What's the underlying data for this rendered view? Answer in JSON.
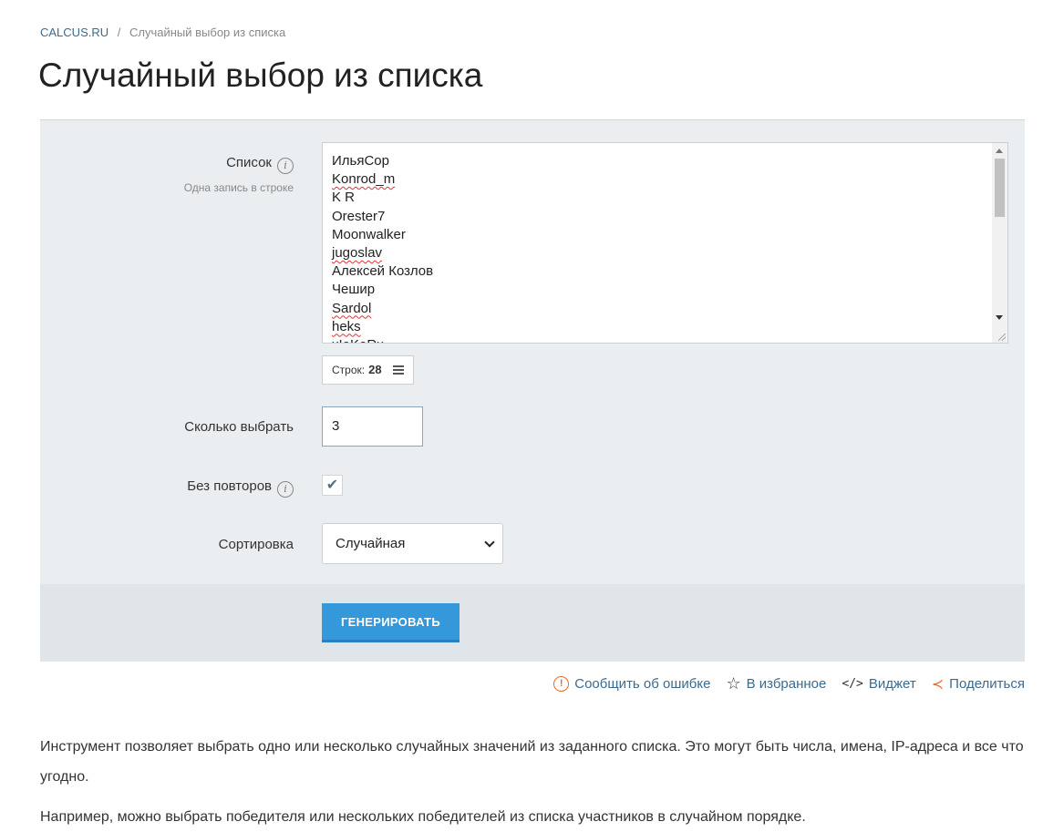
{
  "breadcrumb": {
    "home": "CALCUS.RU",
    "separator": "/",
    "current": "Случайный выбор из списка"
  },
  "page_title": "Случайный выбор из списка",
  "form": {
    "list_label": "Список",
    "list_hint": "Одна запись в строке",
    "list_items": [
      "ИльяCop",
      "Konrod_m",
      "K R",
      "Orester7",
      "Moonwalker",
      "jugoslav",
      "Алексей Козлов",
      "Чешир",
      "Sardol",
      "heks",
      "xIeKeRx"
    ],
    "rows_label": "Строк:",
    "rows_count": "28",
    "count_label": "Сколько выбрать",
    "count_value": "3",
    "norepeat_label": "Без повторов",
    "norepeat_checked": true,
    "sort_label": "Сортировка",
    "sort_value": "Случайная",
    "generate_label": "ГЕНЕРИРОВАТЬ"
  },
  "actions": {
    "report": "Сообщить об ошибке",
    "favorite": "В избранное",
    "widget": "Виджет",
    "share": "Поделиться"
  },
  "description": [
    "Инструмент позволяет выбрать одно или несколько случайных значений из заданного списка. Это могут быть числа, имена, IP-адреса и все что угодно.",
    "Например, можно выбрать победителя или нескольких победителей из списка участников в случайном порядке."
  ],
  "colors": {
    "accent": "#3498db",
    "panel": "#ebeef0",
    "link": "#3a6b8f",
    "icon_orange": "#e06c2e"
  }
}
